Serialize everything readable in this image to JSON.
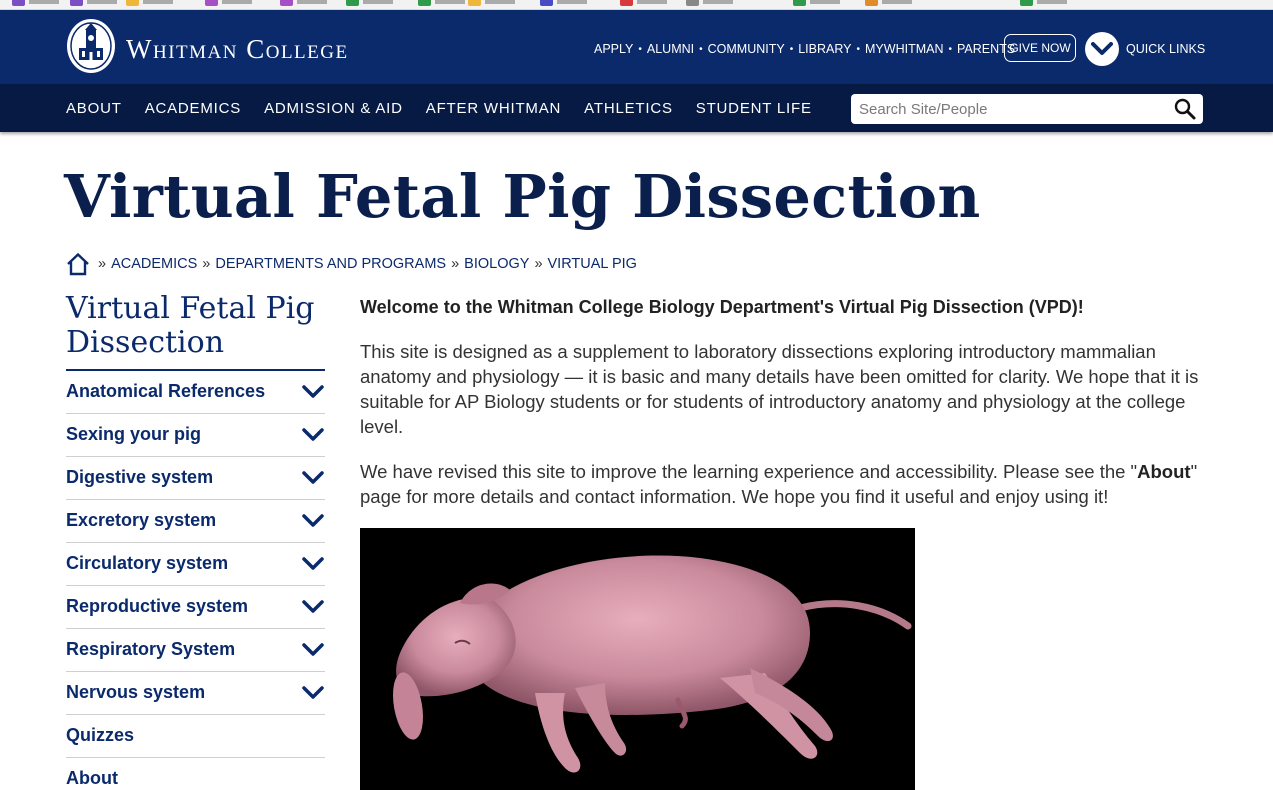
{
  "colors": {
    "primary": "#0b2a6b",
    "nav_dark": "#061a44",
    "title": "#0b1f4d"
  },
  "header": {
    "brand": "Whitman College",
    "utility_links": [
      "APPLY",
      "ALUMNI",
      "COMMUNITY",
      "LIBRARY",
      "MYWHITMAN",
      "PARENTS"
    ],
    "give_label": "GIVE NOW",
    "quick_links_label": "QUICK LINKS"
  },
  "nav": {
    "items": [
      "ABOUT",
      "ACADEMICS",
      "ADMISSION & AID",
      "AFTER WHITMAN",
      "ATHLETICS",
      "STUDENT LIFE"
    ],
    "search_placeholder": "Search Site/People"
  },
  "page": {
    "title": "Virtual Fetal Pig Dissection"
  },
  "breadcrumb": [
    "ACADEMICS",
    "DEPARTMENTS AND PROGRAMS",
    "BIOLOGY",
    "VIRTUAL PIG"
  ],
  "sidebar": {
    "title": "Virtual Fetal Pig Dissection",
    "items": [
      {
        "label": "Anatomical References",
        "expandable": true
      },
      {
        "label": "Sexing your pig",
        "expandable": true
      },
      {
        "label": "Digestive system",
        "expandable": true
      },
      {
        "label": "Excretory system",
        "expandable": true
      },
      {
        "label": "Circulatory system",
        "expandable": true
      },
      {
        "label": "Reproductive system",
        "expandable": true
      },
      {
        "label": "Respiratory System",
        "expandable": true
      },
      {
        "label": "Nervous system",
        "expandable": true
      },
      {
        "label": "Quizzes",
        "expandable": false
      },
      {
        "label": "About",
        "expandable": false
      }
    ]
  },
  "main": {
    "lead": "Welcome to the Whitman College Biology Department's Virtual Pig Dissection (VPD)!",
    "para1": "This site is designed as a supplement to laboratory dissections exploring introductory mammalian anatomy and physiology — it is basic and many details have been omitted for clarity.  We hope that it is suitable for AP Biology students or for students of introductory anatomy and physiology at the college level.",
    "para2_before": "We have revised this site to improve the learning experience and accessibility. Please see the \"",
    "para2_bold": "About",
    "para2_after": "\" page for more details and contact information. We hope you find it useful and enjoy using it!"
  }
}
